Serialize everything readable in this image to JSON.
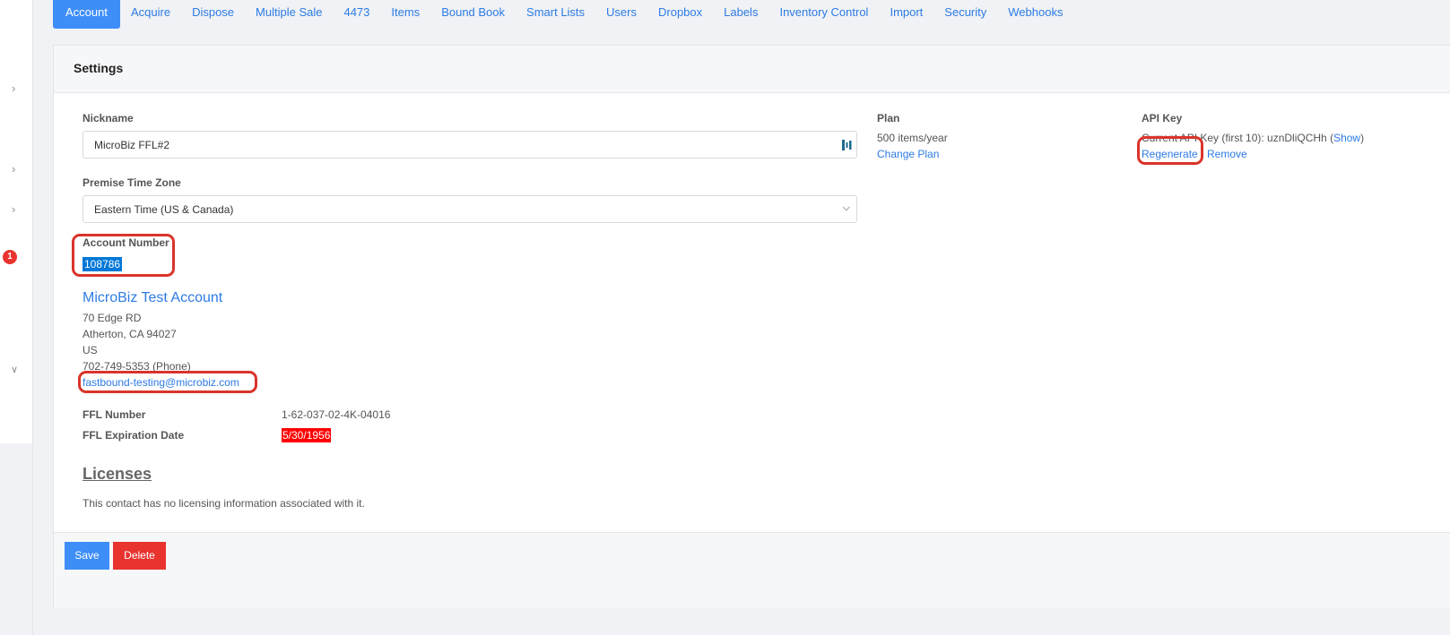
{
  "tabs": [
    "Account",
    "Acquire",
    "Dispose",
    "Multiple Sale",
    "4473",
    "Items",
    "Bound Book",
    "Smart Lists",
    "Users",
    "Dropbox",
    "Labels",
    "Inventory Control",
    "Import",
    "Security",
    "Webhooks"
  ],
  "rail": {
    "badge_count": "1"
  },
  "settings": {
    "title": "Settings",
    "nickname_label": "Nickname",
    "nickname_value": "MicroBiz FFL#2",
    "timezone_label": "Premise Time Zone",
    "timezone_value": "Eastern Time (US & Canada)",
    "account_number_label": "Account Number",
    "account_number": "108786",
    "company_name": "MicroBiz Test Account",
    "address_line1": "70 Edge RD",
    "address_line2": "Atherton, CA 94027",
    "country": "US",
    "phone": "702-749-5353 (Phone)",
    "email": "fastbound-testing@microbiz.com",
    "ffl_number_label": "FFL Number",
    "ffl_number": "1-62-037-02-4K-04016",
    "ffl_exp_label": "FFL Expiration Date",
    "ffl_exp_date": "5/30/1956",
    "licenses_heading": "Licenses",
    "licenses_empty": "This contact has no licensing information associated with it."
  },
  "plan": {
    "label": "Plan",
    "value": "500 items/year",
    "change_link": "Change Plan"
  },
  "api_key": {
    "label": "API Key",
    "current_text": "Current API Key (first 10): uznDliQCHh (",
    "show_link": "Show",
    "close_paren": ")",
    "regenerate_link": "Regenerate",
    "remove_link": "Remove"
  },
  "footer": {
    "save": "Save",
    "delete": "Delete"
  },
  "colors": {
    "accent": "#3e8ef7",
    "danger": "#e8332f",
    "annotation": "#d9342b",
    "selection": "#0078d7"
  }
}
